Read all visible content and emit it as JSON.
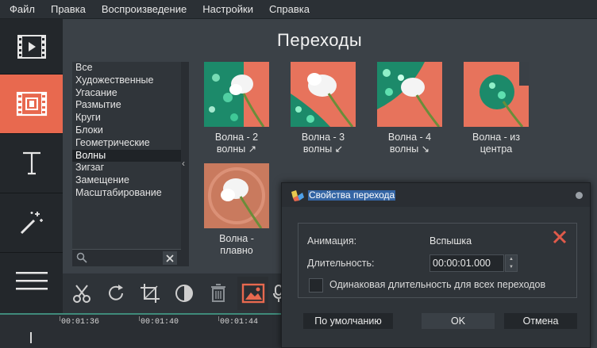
{
  "menubar": {
    "items": [
      "Файл",
      "Правка",
      "Воспроизведение",
      "Настройки",
      "Справка"
    ]
  },
  "sidebar": {
    "items": [
      {
        "name": "media",
        "icon": "film-play-icon"
      },
      {
        "name": "transitions",
        "icon": "transition-icon",
        "active": true
      },
      {
        "name": "titles",
        "icon": "text-t-icon"
      },
      {
        "name": "effects",
        "icon": "magic-wand-icon"
      },
      {
        "name": "more",
        "icon": "hamburger-menu-icon"
      }
    ]
  },
  "main": {
    "title": "Переходы",
    "categories": [
      "Все",
      "Художественные",
      "Угасание",
      "Размытие",
      "Круги",
      "Блоки",
      "Геометрические",
      "Волны",
      "Зигзаг",
      "Замещение",
      "Масштабирование"
    ],
    "selected_category": "Волны",
    "transitions": [
      {
        "label_line1": "Волна - 2",
        "label_line2": "волны ↗"
      },
      {
        "label_line1": "Волна - 3",
        "label_line2": "волны ↙"
      },
      {
        "label_line1": "Волна - 4",
        "label_line2": "волны ↘"
      },
      {
        "label_line1": "Волна - из",
        "label_line2": "центра"
      },
      {
        "label_line1": "Волна -",
        "label_line2": "плавно"
      }
    ]
  },
  "toolbar": {
    "icons": [
      "scissors-icon",
      "rotate-icon",
      "crop-icon",
      "color-adjust-icon",
      "trash-icon",
      "image-icon",
      "mic-icon"
    ]
  },
  "timeline": {
    "times": [
      "00:01:36",
      "00:01:40",
      "00:01:44"
    ]
  },
  "dialog": {
    "title": "Свойства перехода",
    "animation_label": "Анимация:",
    "animation_value": "Вспышка",
    "duration_label": "Длительность:",
    "duration_value": "00:00:01.000",
    "same_duration_label": "Одинаковая длительность для всех переходов",
    "btn_default": "По умолчанию",
    "btn_ok": "OK",
    "btn_cancel": "Отмена"
  },
  "colors": {
    "accent": "#e8694f",
    "sidebar_bg": "#23272b",
    "main_bg": "#3b4147",
    "dialog_title_highlight": "#3465a4",
    "close_red": "#e05a4a",
    "timeline_line": "#3f8a7a"
  }
}
